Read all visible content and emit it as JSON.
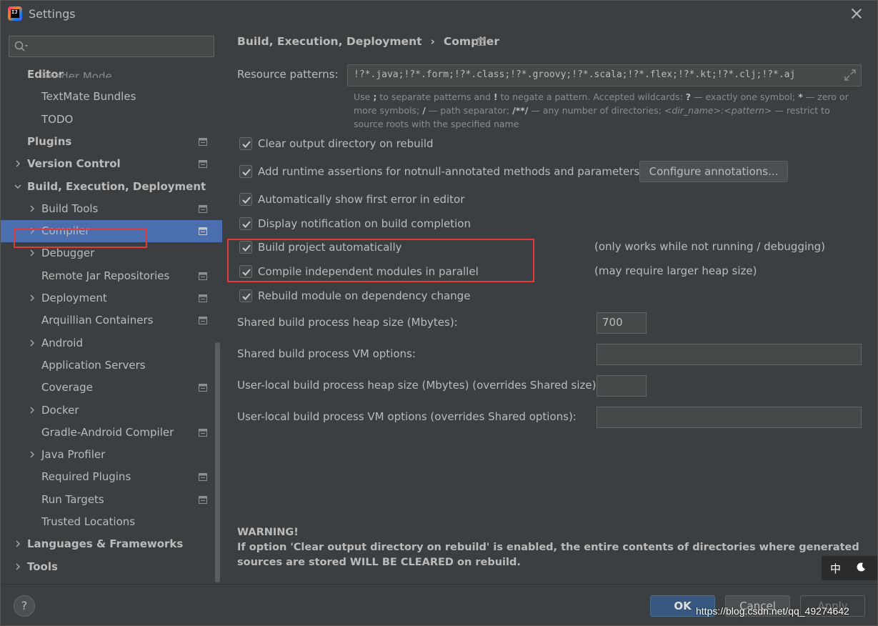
{
  "window": {
    "title": "Settings",
    "logo_text": "IJ"
  },
  "sidebar": {
    "search_placeholder": "",
    "partial_item": "Reader Mode",
    "items": [
      {
        "label": "Editor",
        "bold": true,
        "level": 0,
        "arrow": false,
        "icon": false
      },
      {
        "label": "TextMate Bundles",
        "bold": false,
        "level": 1,
        "arrow": false,
        "icon": false
      },
      {
        "label": "TODO",
        "bold": false,
        "level": 1,
        "arrow": false,
        "icon": false
      },
      {
        "label": "Plugins",
        "bold": true,
        "level": 0,
        "arrow": false,
        "icon": true
      },
      {
        "label": "Version Control",
        "bold": true,
        "level": 0,
        "arrow": "right",
        "icon": true
      },
      {
        "label": "Build, Execution, Deployment",
        "bold": true,
        "level": 0,
        "arrow": "down",
        "icon": false
      },
      {
        "label": "Build Tools",
        "bold": false,
        "level": 1,
        "arrow": "right",
        "icon": true
      },
      {
        "label": "Compiler",
        "bold": false,
        "level": 1,
        "arrow": "right",
        "icon": true,
        "selected": true
      },
      {
        "label": "Debugger",
        "bold": false,
        "level": 1,
        "arrow": "right",
        "icon": false
      },
      {
        "label": "Remote Jar Repositories",
        "bold": false,
        "level": 1,
        "arrow": false,
        "icon": true
      },
      {
        "label": "Deployment",
        "bold": false,
        "level": 1,
        "arrow": "right",
        "icon": true
      },
      {
        "label": "Arquillian Containers",
        "bold": false,
        "level": 1,
        "arrow": false,
        "icon": true
      },
      {
        "label": "Android",
        "bold": false,
        "level": 1,
        "arrow": "right",
        "icon": false
      },
      {
        "label": "Application Servers",
        "bold": false,
        "level": 1,
        "arrow": false,
        "icon": false
      },
      {
        "label": "Coverage",
        "bold": false,
        "level": 1,
        "arrow": false,
        "icon": true
      },
      {
        "label": "Docker",
        "bold": false,
        "level": 1,
        "arrow": "right",
        "icon": false
      },
      {
        "label": "Gradle-Android Compiler",
        "bold": false,
        "level": 1,
        "arrow": false,
        "icon": true
      },
      {
        "label": "Java Profiler",
        "bold": false,
        "level": 1,
        "arrow": "right",
        "icon": false
      },
      {
        "label": "Required Plugins",
        "bold": false,
        "level": 1,
        "arrow": false,
        "icon": true
      },
      {
        "label": "Run Targets",
        "bold": false,
        "level": 1,
        "arrow": false,
        "icon": true
      },
      {
        "label": "Trusted Locations",
        "bold": false,
        "level": 1,
        "arrow": false,
        "icon": false
      },
      {
        "label": "Languages & Frameworks",
        "bold": true,
        "level": 0,
        "arrow": "right",
        "icon": false
      },
      {
        "label": "Tools",
        "bold": true,
        "level": 0,
        "arrow": "right",
        "icon": false
      }
    ]
  },
  "content": {
    "breadcrumb": {
      "parent": "Build, Execution, Deployment",
      "separator": "›",
      "current": "Compiler"
    },
    "resource_patterns": {
      "label": "Resource patterns:",
      "value": "!?*.java;!?*.form;!?*.class;!?*.groovy;!?*.scala;!?*.flex;!?*.kt;!?*.clj;!?*.aj"
    },
    "hint": {
      "line1_a": "Use ",
      "semicolon": ";",
      "line1_b": " to separate patterns and ",
      "bang": "!",
      "line1_c": " to negate a pattern. Accepted wildcards: ",
      "q": "?",
      "line1_d": " — exactly one symbol; ",
      "star": "*",
      "line1_e": " — zero or more symbols; ",
      "slash": "/",
      "line1_f": " — path separator; ",
      "dstar": "/**/",
      "line1_g": " — any number of directories; ",
      "dirname": "<dir_name>:<pattern>",
      "line1_h": " — restrict to source roots with the specified name"
    },
    "checkboxes": {
      "clear_output": {
        "label": "Clear output directory on rebuild",
        "checked": true
      },
      "runtime_assertions": {
        "label": "Add runtime assertions for notnull-annotated methods and parameters",
        "checked": true
      },
      "show_first_error": {
        "label": "Automatically show first error in editor",
        "checked": true
      },
      "display_notification": {
        "label": "Display notification on build completion",
        "checked": true
      },
      "build_auto": {
        "label": "Build project automatically",
        "checked": true,
        "note": "(only works while not running / debugging)"
      },
      "compile_parallel": {
        "label": "Compile independent modules in parallel",
        "checked": true,
        "note": "(may require larger heap size)"
      },
      "rebuild_on_dep": {
        "label": "Rebuild module on dependency change",
        "checked": true
      }
    },
    "configure_button": "Configure annotations...",
    "fields": {
      "shared_heap": {
        "label": "Shared build process heap size (Mbytes):",
        "value": "700"
      },
      "shared_vm": {
        "label": "Shared build process VM options:",
        "value": ""
      },
      "local_heap": {
        "label": "User-local build process heap size (Mbytes) (overrides Shared size):",
        "value": ""
      },
      "local_vm": {
        "label": "User-local build process VM options (overrides Shared options):",
        "value": ""
      }
    },
    "warning": {
      "title": "WARNING!",
      "text": "If option 'Clear output directory on rebuild' is enabled, the entire contents of directories where generated sources are stored WILL BE CLEARED on rebuild."
    }
  },
  "footer": {
    "help": "?",
    "ok": "OK",
    "cancel": "Cancel",
    "apply": "Apply"
  },
  "overlay": {
    "ime_char": "中",
    "watermark": "https://blog.csdn.net/qq_49274642"
  },
  "colors": {
    "background": "#3c3f41",
    "selection": "#4b6eaf",
    "highlight_box": "#e53935",
    "ok_button": "#365880"
  }
}
